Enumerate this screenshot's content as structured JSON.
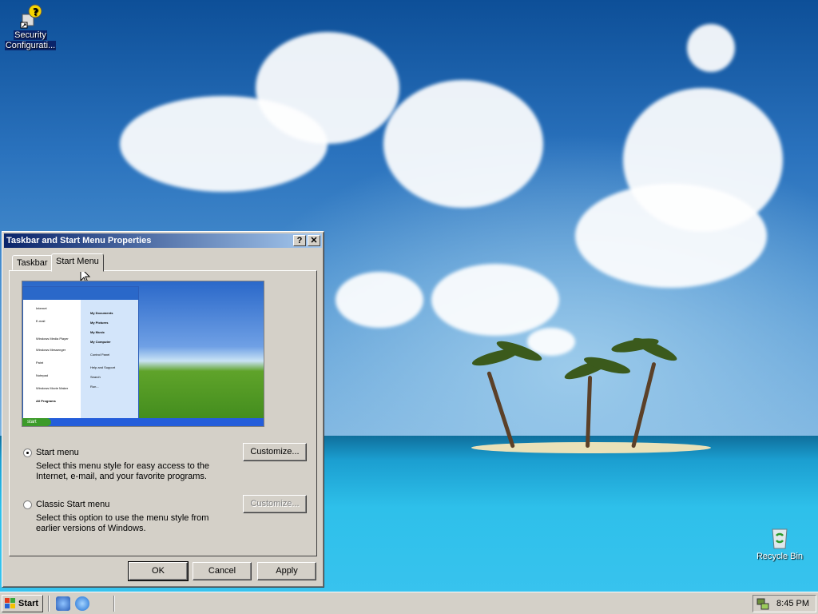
{
  "desktop": {
    "icons": [
      {
        "label_line1": "Security",
        "label_line2": "Configurati..."
      },
      {
        "label_line1": "Recycle Bin"
      }
    ]
  },
  "dialog": {
    "title": "Taskbar and Start Menu Properties",
    "help_button": "?",
    "close_button": "✕",
    "tabs": [
      {
        "label": "Taskbar",
        "active": false
      },
      {
        "label": "Start Menu",
        "active": true
      }
    ],
    "preview": {
      "left_items": [
        "Internet",
        "E-mail",
        "Windows Media Player",
        "Windows Messenger",
        "Paint",
        "Notepad",
        "Windows Movie Maker",
        "All Programs"
      ],
      "right_items": [
        "My Documents",
        "My Pictures",
        "My Music",
        "My Computer",
        "Control Panel",
        "Help and Support",
        "Search",
        "Run..."
      ],
      "start_label": "start"
    },
    "options": [
      {
        "label": "Start menu",
        "selected": true,
        "desc_line1": "Select this menu style for easy access to the",
        "desc_line2": "Internet, e-mail, and your favorite programs.",
        "customize": "Customize...",
        "customize_enabled": true
      },
      {
        "label": "Classic Start menu",
        "selected": false,
        "desc_line1": "Select this option to use the menu style from",
        "desc_line2": "earlier versions of Windows.",
        "customize": "Customize...",
        "customize_enabled": false
      }
    ],
    "buttons": {
      "ok": "OK",
      "cancel": "Cancel",
      "apply": "Apply"
    }
  },
  "taskbar": {
    "start_label": "Start",
    "clock": "8:45 PM"
  },
  "colors": {
    "titlebar_start": "#0a246a",
    "titlebar_end": "#a6caf0",
    "face": "#d4d0c8"
  }
}
